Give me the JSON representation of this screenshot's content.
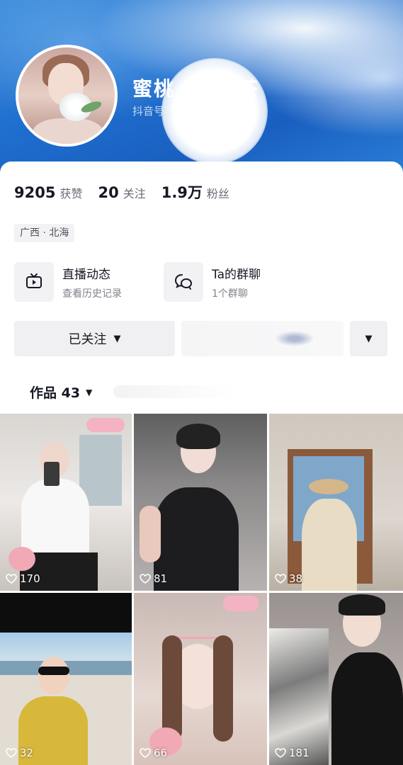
{
  "profile": {
    "nickname_start": "蜜桃",
    "nickname_end": "茶",
    "douyin_id_prefix": "抖音号"
  },
  "stats": [
    {
      "value": "9205",
      "label": "获赞"
    },
    {
      "value": "20",
      "label": "关注"
    },
    {
      "value": "1.9万",
      "label": "粉丝"
    }
  ],
  "location": "广西 · 北海",
  "features": {
    "live": {
      "title": "直播动态",
      "subtitle": "查看历史记录",
      "icon": "tv-icon"
    },
    "group": {
      "title": "Ta的群聊",
      "subtitle": "1个群聊",
      "icon": "chat-bubbles-icon"
    }
  },
  "buttons": {
    "followed": "已关注",
    "more_caret": "▼"
  },
  "tabs": {
    "works_label": "作品 43"
  },
  "videos": [
    {
      "likes": "170"
    },
    {
      "likes": "81"
    },
    {
      "likes": "38"
    },
    {
      "likes": "32"
    },
    {
      "likes": "66"
    },
    {
      "likes": "181"
    }
  ],
  "colors": {
    "banner_blue": "#1f6fce",
    "text_primary": "#161823",
    "text_secondary": "#6b6d76",
    "button_bg": "#f0f0f2"
  }
}
